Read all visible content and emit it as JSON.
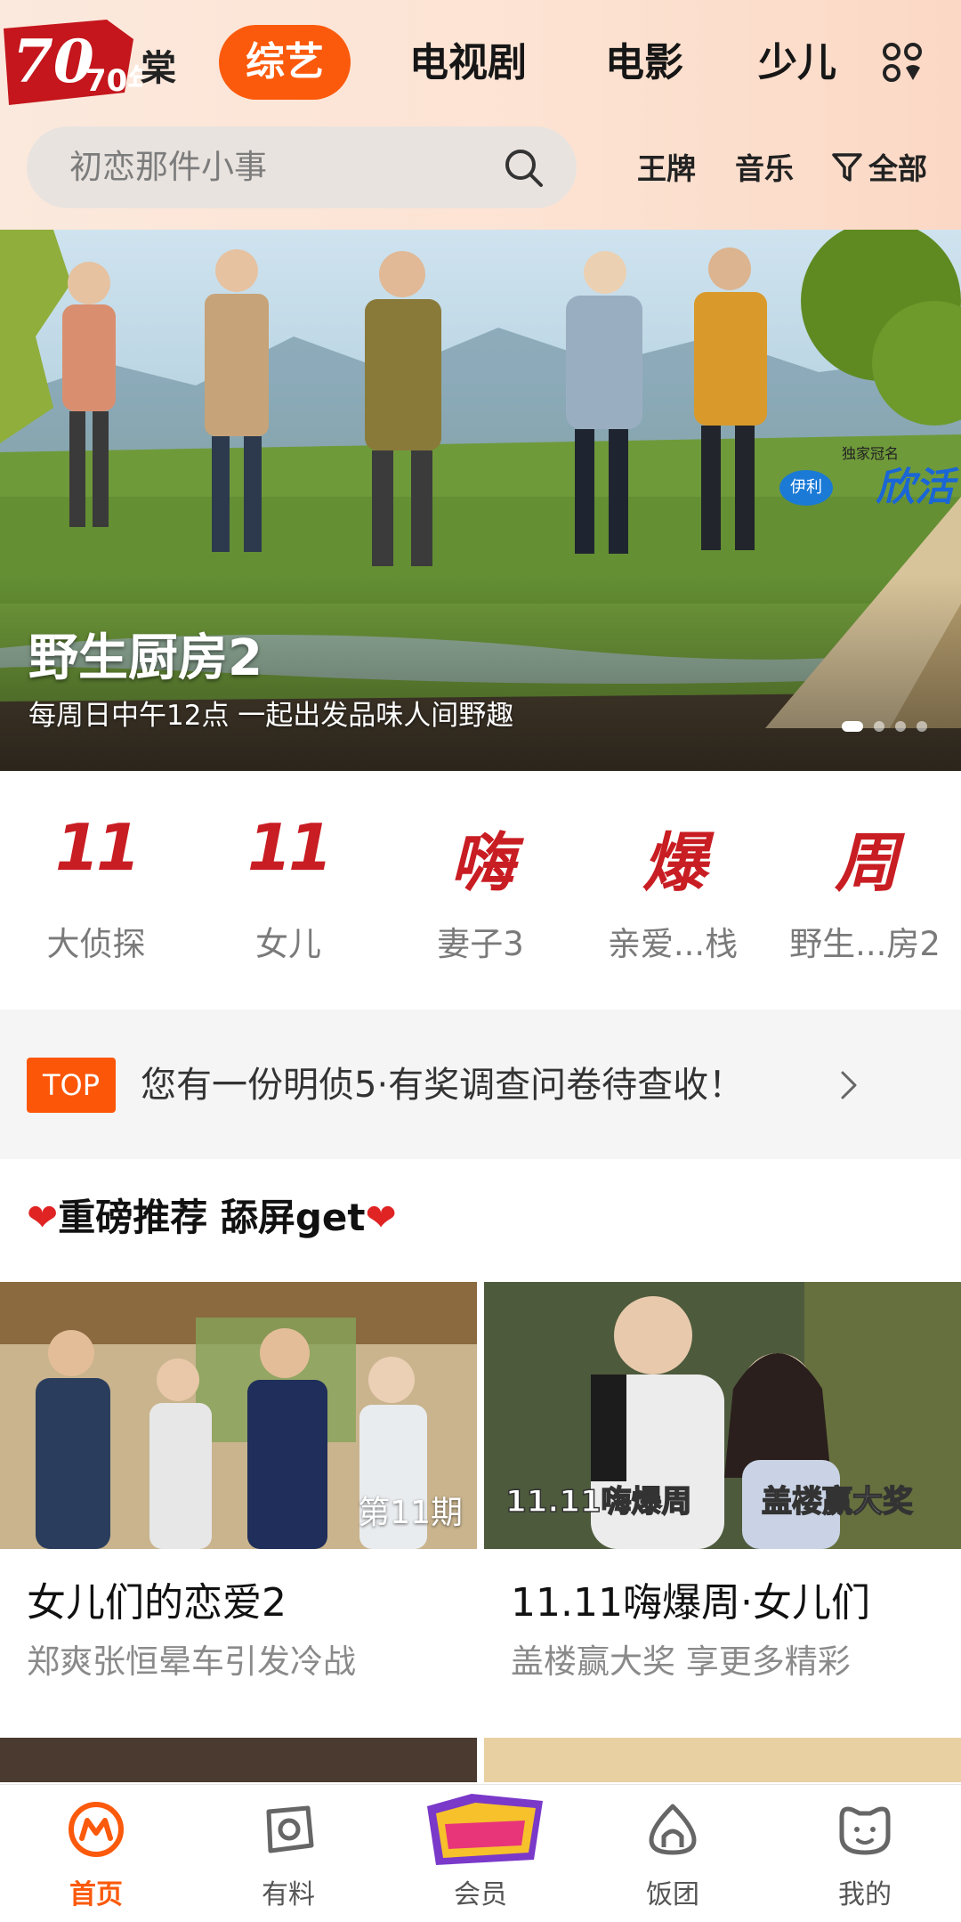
{
  "header": {
    "logo_text": "70年",
    "logo_trail": "棠",
    "tabs": [
      {
        "label": "综艺",
        "active": true
      },
      {
        "label": "电视剧",
        "active": false
      },
      {
        "label": "电影",
        "active": false
      },
      {
        "label": "少儿",
        "active": false
      }
    ],
    "apps_icon": "grid-apps-icon",
    "search": {
      "placeholder": "初恋那件小事",
      "icon": "search-icon"
    },
    "quick_links": [
      "王牌",
      "音乐"
    ],
    "filter_label": "全部",
    "filter_icon": "funnel-icon"
  },
  "banner": {
    "title": "野生厨房2",
    "subtitle": "每周日中午12点  一起出发品味人间野趣",
    "sponsor_top": "独家冠名",
    "sponsor_brand": "欣活",
    "sponsor_badge": "伊利",
    "pages": 4,
    "current_page": 1
  },
  "promo": [
    {
      "big": "11",
      "label": "大侦探"
    },
    {
      "big": "11",
      "label": "女儿"
    },
    {
      "big": "嗨",
      "label": "妻子3"
    },
    {
      "big": "爆",
      "label": "亲爱...栈"
    },
    {
      "big": "周",
      "label": "野生...房2"
    }
  ],
  "notice": {
    "badge": "TOP",
    "text": "您有一份明侦5·有奖调查问卷待查收！"
  },
  "section": {
    "title": "重磅推荐 舔屏get",
    "heart": "❤"
  },
  "cards": [
    {
      "title": "女儿们的恋爱2",
      "subtitle": "郑爽张恒晕车引发冷战",
      "episode": "第11期"
    },
    {
      "title": "11.11嗨爆周·女儿们",
      "subtitle": "盖楼赢大奖 享更多精彩",
      "overlay_left": "11.11嗨爆周",
      "overlay_right": "盖楼赢大奖"
    }
  ],
  "bottom_nav": [
    {
      "label": "首页",
      "icon": "home-m-icon",
      "active": true
    },
    {
      "label": "有料",
      "icon": "discover-icon",
      "active": false
    },
    {
      "label": "会员",
      "icon": "vip-banner-icon",
      "active": false
    },
    {
      "label": "饭团",
      "icon": "rice-ball-icon",
      "active": false
    },
    {
      "label": "我的",
      "icon": "profile-face-icon",
      "active": false
    }
  ],
  "colors": {
    "accent": "#fb5a0c",
    "promo_red": "#c81d23",
    "header_bg": "#fde3d3",
    "notice_bg": "#f5f5f6"
  }
}
